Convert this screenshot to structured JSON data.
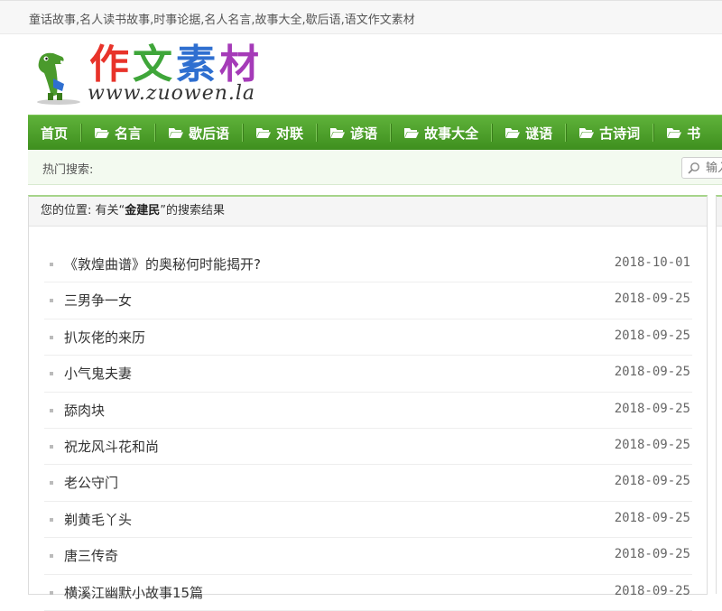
{
  "header": {
    "tagline": "童话故事,名人读书故事,时事论据,名人名言,故事大全,歇后语,语文作文素材",
    "logo": {
      "chars": [
        "作",
        "文",
        "素",
        "材"
      ],
      "url": "www.zuowen.la",
      "char_colors": [
        "#e8332a",
        "#3fa63a",
        "#2f6fd0",
        "#a53bb8"
      ]
    }
  },
  "nav": {
    "items": [
      {
        "label": "首页",
        "icon": ""
      },
      {
        "label": "名言",
        "icon": "folder-icon"
      },
      {
        "label": "歇后语",
        "icon": "folder-icon"
      },
      {
        "label": "对联",
        "icon": "folder-icon"
      },
      {
        "label": "谚语",
        "icon": "folder-icon"
      },
      {
        "label": "故事大全",
        "icon": "folder-icon"
      },
      {
        "label": "谜语",
        "icon": "folder-icon"
      },
      {
        "label": "古诗词",
        "icon": "folder-icon"
      },
      {
        "label": "书",
        "icon": "folder-icon"
      }
    ]
  },
  "hot_search": {
    "label": "热门搜索:",
    "search_placeholder": "输入"
  },
  "breadcrumb": {
    "prefix": "您的位置: 有关“",
    "keyword": "金建民",
    "suffix": "”的搜索结果"
  },
  "results": [
    {
      "title": "《敦煌曲谱》的奥秘何时能揭开?",
      "date": "2018-10-01"
    },
    {
      "title": "三男争一女",
      "date": "2018-09-25"
    },
    {
      "title": "扒灰佬的来历",
      "date": "2018-09-25"
    },
    {
      "title": "小气鬼夫妻",
      "date": "2018-09-25"
    },
    {
      "title": "舔肉块",
      "date": "2018-09-25"
    },
    {
      "title": "祝龙风斗花和尚",
      "date": "2018-09-25"
    },
    {
      "title": "老公守门",
      "date": "2018-09-25"
    },
    {
      "title": "剃黄毛丫头",
      "date": "2018-09-25"
    },
    {
      "title": "唐三传奇",
      "date": "2018-09-25"
    },
    {
      "title": "横溪江幽默小故事15篇",
      "date": "2018-09-25"
    }
  ]
}
